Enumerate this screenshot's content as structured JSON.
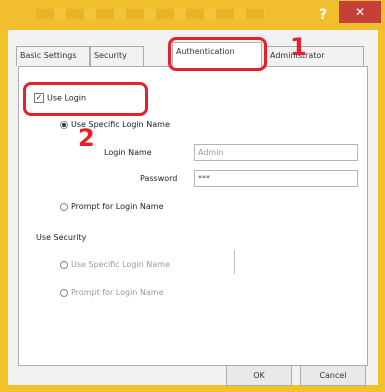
{
  "window": {
    "title": "",
    "help_label": "?",
    "close_label": "✕"
  },
  "tabs": [
    {
      "label": "Basic Settings"
    },
    {
      "label": "Security"
    },
    {
      "label": "Authentication"
    },
    {
      "label": "Administrator"
    }
  ],
  "callouts": {
    "step1": "1",
    "step2": "2"
  },
  "settings": {
    "use_login_label": "Use Login",
    "option_specific_label": "Use Specific Login Name",
    "login_name_label": "Login Name",
    "login_name_placeholder": "Admin",
    "password_label": "Password",
    "password_value": "***",
    "option_prompt_label": "Prompt for Login Name",
    "section_label": "Use Security",
    "option_specific_dim_label": "Use Specific Login Name",
    "option_prompt_dim_label": "Prompt for Login Name"
  },
  "buttons": {
    "ok_label": "OK",
    "cancel_label": "Cancel"
  },
  "colors": {
    "titlebar": "#f1bf2d",
    "close": "#c6403a",
    "highlight": "#e8202b"
  }
}
